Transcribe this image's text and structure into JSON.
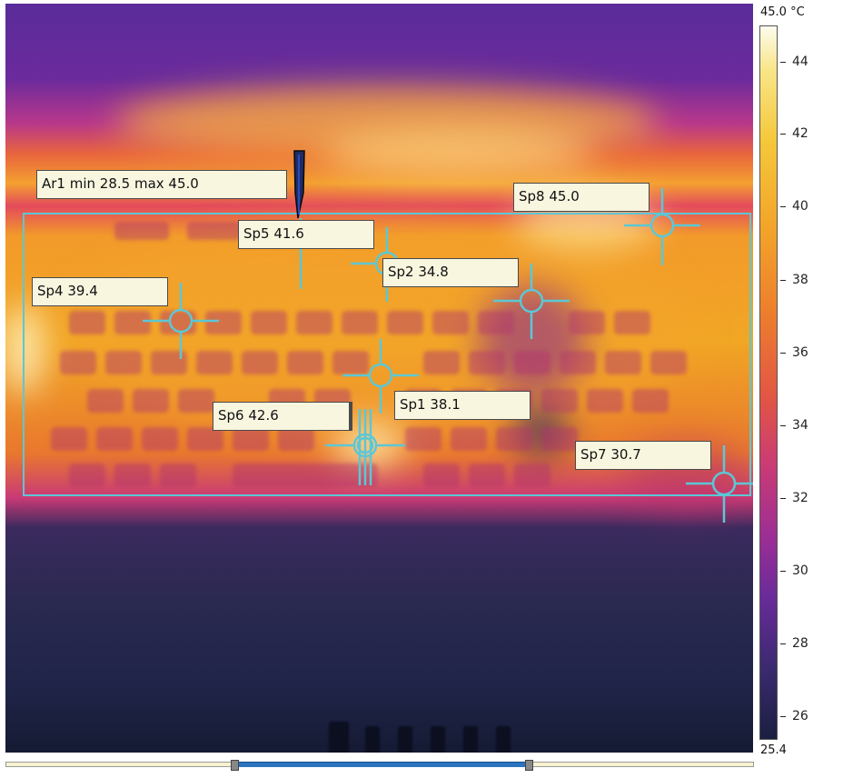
{
  "area": {
    "label": "Ar1 min 28.5 max 45.0"
  },
  "spots": [
    {
      "label": "Sp1 38.1"
    },
    {
      "label": "Sp2 34.8"
    },
    {
      "label": "Sp4 39.4"
    },
    {
      "label": "Sp5 41.6"
    },
    {
      "label": "Sp6 42.6"
    },
    {
      "label": "Sp7 30.7"
    },
    {
      "label": "Sp8 45.0"
    }
  ],
  "scale": {
    "max_label": "45.0 °C",
    "min_label": "25.4",
    "ticks": [
      "44",
      "42",
      "40",
      "38",
      "36",
      "34",
      "32",
      "30",
      "28",
      "26"
    ]
  },
  "colors": {
    "marker": "#5cc7d6",
    "label_bg": "#f9f6e0",
    "palette": "iron"
  },
  "icons": {
    "cursor": "pen-cursor-icon"
  }
}
